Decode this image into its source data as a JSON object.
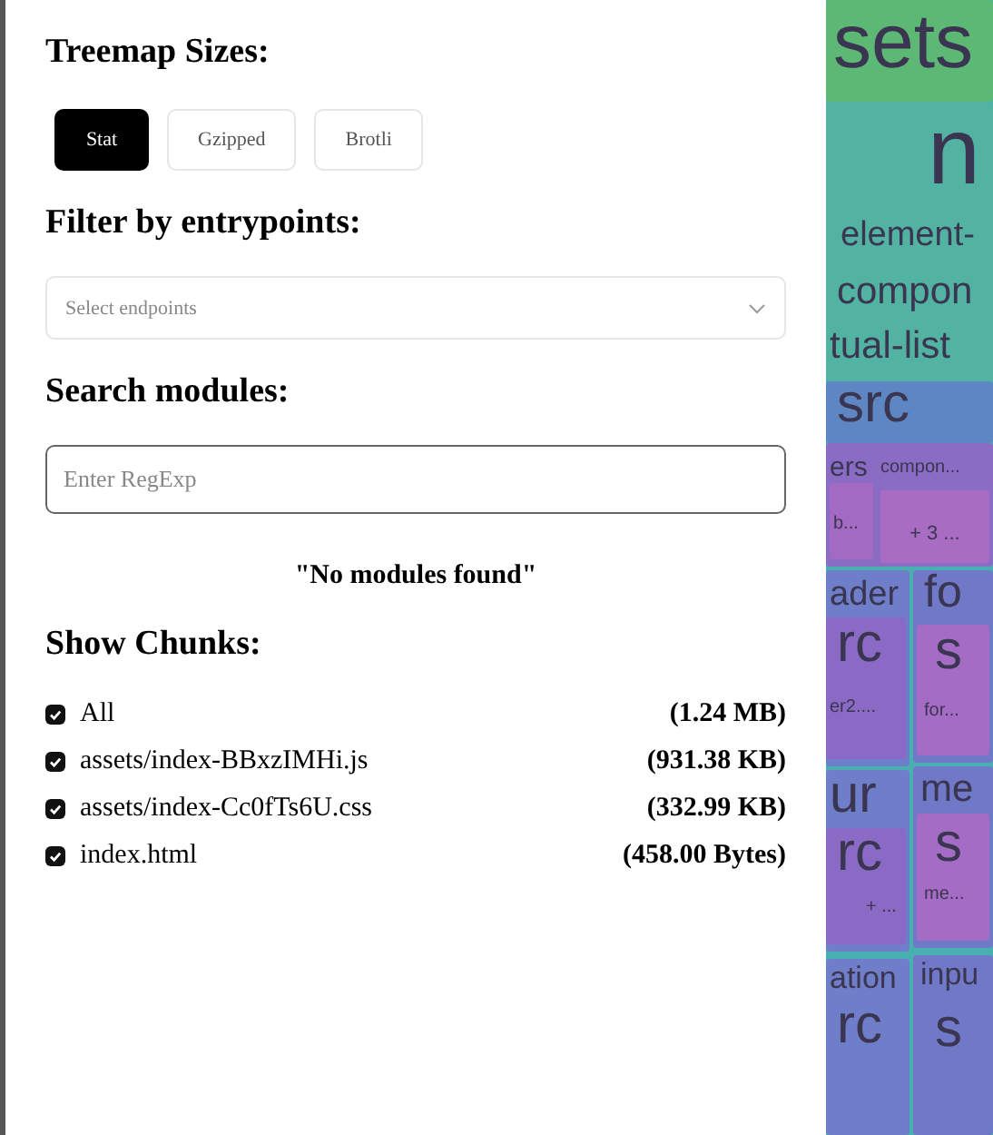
{
  "sizes": {
    "title": "Treemap Sizes:",
    "options": [
      {
        "label": "Stat",
        "selected": true
      },
      {
        "label": "Gzipped",
        "selected": false
      },
      {
        "label": "Brotli",
        "selected": false
      }
    ]
  },
  "filter": {
    "title": "Filter by entrypoints:",
    "placeholder": "Select endpoints"
  },
  "search": {
    "title": "Search modules:",
    "placeholder": "Enter RegExp",
    "message": "\"No modules found\""
  },
  "chunks": {
    "title": "Show Chunks:",
    "items": [
      {
        "name": "All",
        "size": "(1.24 MB)",
        "checked": true
      },
      {
        "name": "assets/index-BBxzIMHi.js",
        "size": "(931.38 KB)",
        "checked": true
      },
      {
        "name": "assets/index-Cc0fTs6U.css",
        "size": "(332.99 KB)",
        "checked": true
      },
      {
        "name": "index.html",
        "size": "(458.00 Bytes)",
        "checked": true
      }
    ]
  },
  "treemap": {
    "labels": [
      "sets",
      "n",
      "element-",
      "compon",
      "tual-list",
      "src",
      "ers",
      "compon...",
      "b...",
      "+ 3 ...",
      "ader",
      "rc",
      "er2....",
      "fo",
      "s",
      "for...",
      "ur",
      "rc",
      "+ ...",
      "me",
      "s",
      "me...",
      "ation",
      "rc",
      "inpu",
      "s"
    ]
  }
}
